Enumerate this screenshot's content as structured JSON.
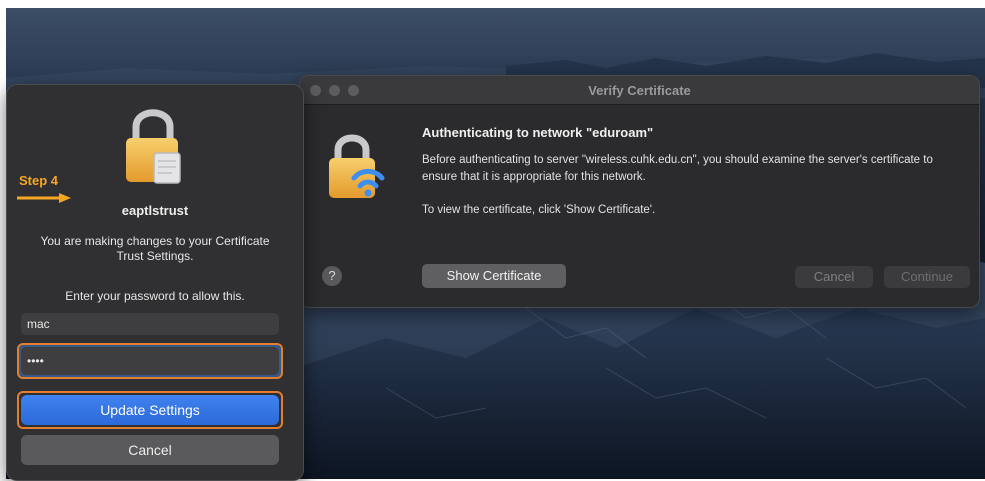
{
  "annotation": {
    "step_label": "Step 4"
  },
  "auth_dialog": {
    "title": "eaptlstrust",
    "message": "You are making changes to your Certificate Trust Settings.",
    "prompt": "Enter your password to allow this.",
    "username_value": "mac",
    "password_value": "••••",
    "update_button": "Update Settings",
    "cancel_button": "Cancel",
    "icon": "lock-icon"
  },
  "verify_window": {
    "title": "Verify Certificate",
    "heading": "Authenticating to network \"eduroam\"",
    "body": "Before authenticating to server \"wireless.cuhk.edu.cn\", you should examine the server's certificate to ensure that it is appropriate for this network.",
    "body2": "To view the certificate, click 'Show Certificate'.",
    "help_label": "?",
    "show_certificate_button": "Show Certificate",
    "cancel_button": "Cancel",
    "continue_button": "Continue",
    "icon": "lock-wifi-icon"
  },
  "colors": {
    "highlight": "#e37e2e",
    "step_label": "#f5a623",
    "primary_button": "#2c6ad8"
  }
}
